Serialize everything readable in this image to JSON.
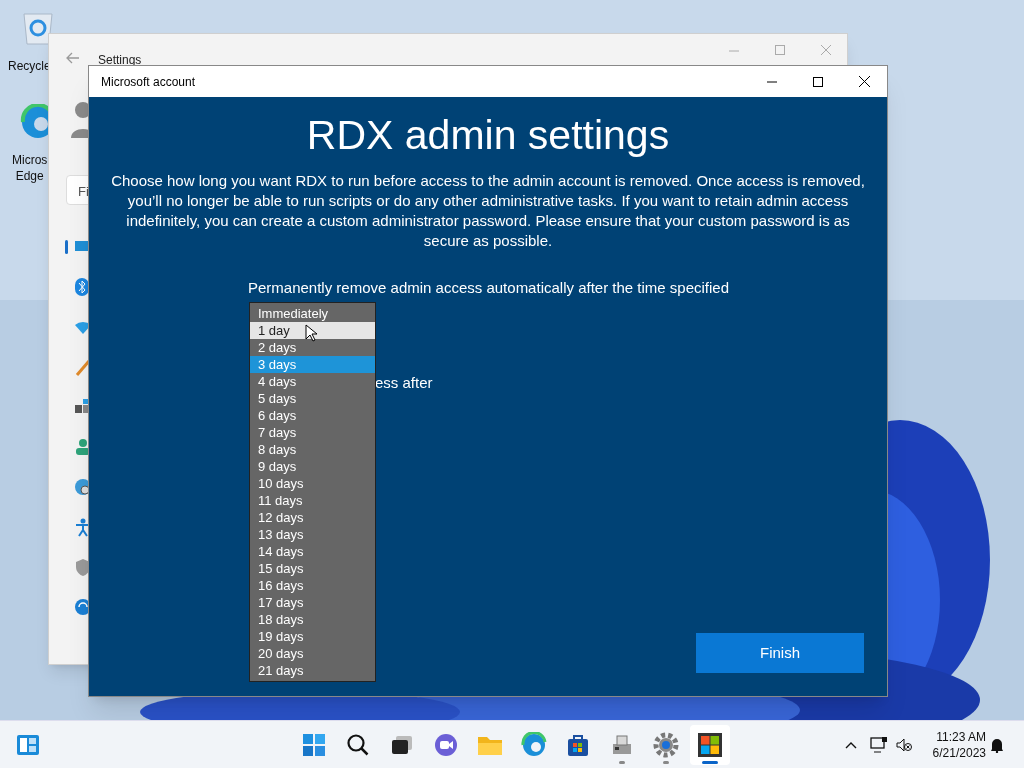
{
  "desktop_icons": [
    {
      "kind": "recycle",
      "label": "Recycle"
    },
    {
      "kind": "edge",
      "label": "Micros\nEdge"
    }
  ],
  "settings_window": {
    "title": "Settings",
    "search": {
      "placeholder": "Fi"
    }
  },
  "dialog": {
    "title": "Microsoft account",
    "heading": "RDX admin settings",
    "description": "Choose how long you want RDX to run before access to the admin account is removed. Once access is removed, you’ll no longer be able to run scripts or do any other administrative tasks. If you want to retain admin access indefinitely, you can create a custom administrator password. Please ensure that your custom password is as secure as possible.",
    "dropdown_label": "Permanently remove admin access automatically after the time specified",
    "covered_label": "ess after",
    "options": [
      {
        "label": "Immediately",
        "selected": false,
        "hovered": false
      },
      {
        "label": "1 day",
        "selected": false,
        "hovered": true
      },
      {
        "label": "2 days",
        "selected": false,
        "hovered": false
      },
      {
        "label": "3 days",
        "selected": true,
        "hovered": false
      },
      {
        "label": "4 days",
        "selected": false,
        "hovered": false
      },
      {
        "label": "5 days",
        "selected": false,
        "hovered": false
      },
      {
        "label": "6 days",
        "selected": false,
        "hovered": false
      },
      {
        "label": "7 days",
        "selected": false,
        "hovered": false
      },
      {
        "label": "8 days",
        "selected": false,
        "hovered": false
      },
      {
        "label": "9 days",
        "selected": false,
        "hovered": false
      },
      {
        "label": "10 days",
        "selected": false,
        "hovered": false
      },
      {
        "label": "11 days",
        "selected": false,
        "hovered": false
      },
      {
        "label": "12 days",
        "selected": false,
        "hovered": false
      },
      {
        "label": "13 days",
        "selected": false,
        "hovered": false
      },
      {
        "label": "14 days",
        "selected": false,
        "hovered": false
      },
      {
        "label": "15 days",
        "selected": false,
        "hovered": false
      },
      {
        "label": "16 days",
        "selected": false,
        "hovered": false
      },
      {
        "label": "17 days",
        "selected": false,
        "hovered": false
      },
      {
        "label": "18 days",
        "selected": false,
        "hovered": false
      },
      {
        "label": "19 days",
        "selected": false,
        "hovered": false
      },
      {
        "label": "20 days",
        "selected": false,
        "hovered": false
      },
      {
        "label": "21 days",
        "selected": false,
        "hovered": false
      }
    ],
    "finish_button": "Finish"
  },
  "taskbar": {
    "apps": [
      {
        "kind": "start",
        "active": false
      },
      {
        "kind": "search",
        "active": false
      },
      {
        "kind": "taskview",
        "active": false
      },
      {
        "kind": "chat",
        "active": false
      },
      {
        "kind": "folder",
        "active": false
      },
      {
        "kind": "edge",
        "active": false
      },
      {
        "kind": "store",
        "active": false
      },
      {
        "kind": "device",
        "active": true
      },
      {
        "kind": "gear",
        "active": true
      },
      {
        "kind": "tiles",
        "active": true
      }
    ],
    "time": "11:23 AM",
    "date": "6/21/2023"
  }
}
